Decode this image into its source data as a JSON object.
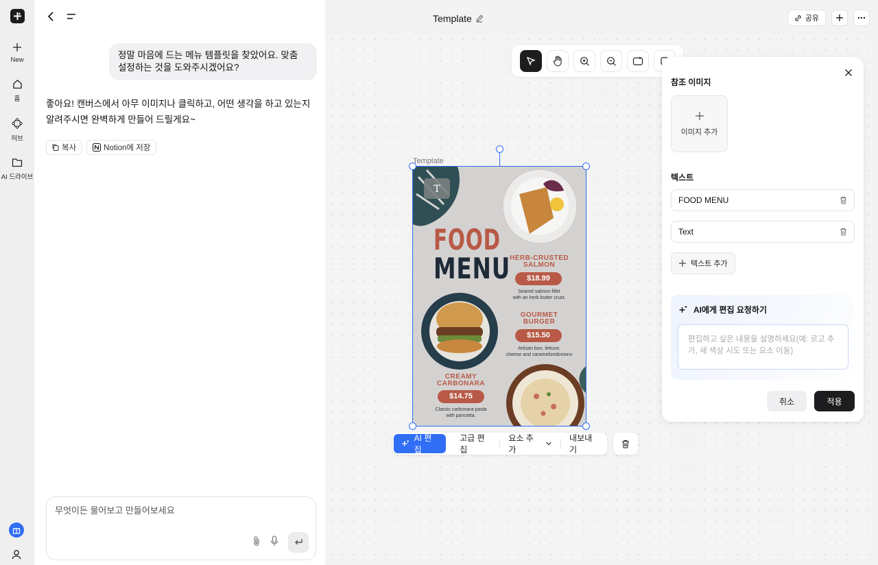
{
  "rail": {
    "items": [
      {
        "label": "New",
        "icon": "plus-icon"
      },
      {
        "label": "홈",
        "icon": "home-icon"
      },
      {
        "label": "허브",
        "icon": "hub-icon"
      },
      {
        "label": "AI 드라이브",
        "icon": "folder-icon"
      }
    ]
  },
  "chat": {
    "user_message": "정말 마음에 드는 메뉴 템플릿을 찾았어요. 맞춤 설정하는 것을 도와주시겠어요?",
    "assistant_reply": "좋아요! 캔버스에서 아무 이미지나 클릭하고, 어떤 생각을 하고 있는지 알려주시면 완벽하게 만들어 드릴게요~",
    "copy_label": "복사",
    "notion_label": "Notion에 저장",
    "composer_placeholder": "무엇이든 물어보고 만들어보세요"
  },
  "header": {
    "title": "Template",
    "share_label": "공유"
  },
  "canvas": {
    "template_label": "Template"
  },
  "poster": {
    "title_line1": "FOOD",
    "title_line2": "MENU",
    "item1_name_1": "HERB-CRUSTED",
    "item1_name_2": "SALMON",
    "item1_price": "$18.99",
    "item1_desc_1": "Seared salmon fillet",
    "item1_desc_2": "with an herb butter crust.",
    "item2_name_1": "GOURMET",
    "item2_name_2": "BURGER",
    "item2_price": "$15.50",
    "item2_desc_1": "Artisan bun, lettuce,",
    "item2_desc_2": "cheese and caramelizedonions",
    "item3_name_1": "CREAMY",
    "item3_name_2": "CARBONARA",
    "item3_price": "$14.75",
    "item3_desc_1": "Classic carbonara pasta",
    "item3_desc_2": "with pancetta.",
    "colors": {
      "accent": "#b85a47",
      "dark": "#1e2a38",
      "bg": "#d4d2d1"
    }
  },
  "actionbar": {
    "ai_edit": "AI 편집",
    "advanced_edit": "고급 편집",
    "add_element": "요소 추가",
    "export": "내보내기"
  },
  "panel": {
    "ref_image_heading": "참조 이미지",
    "add_image": "이미지 추가",
    "text_heading": "텍스트",
    "texts": [
      "FOOD MENU",
      "Text"
    ],
    "add_text": "텍스트 추가",
    "ai_heading": "AI에게 편집 요청하기",
    "ai_placeholder": "편집하고 싶은 내용을 설명하세요(예: 로고 추가, 새 색상 시도 또는 요소 이동)",
    "cancel": "취소",
    "apply": "적용"
  },
  "colors": {
    "primary": "#2f6ef5",
    "dark": "#1d1d1f"
  }
}
